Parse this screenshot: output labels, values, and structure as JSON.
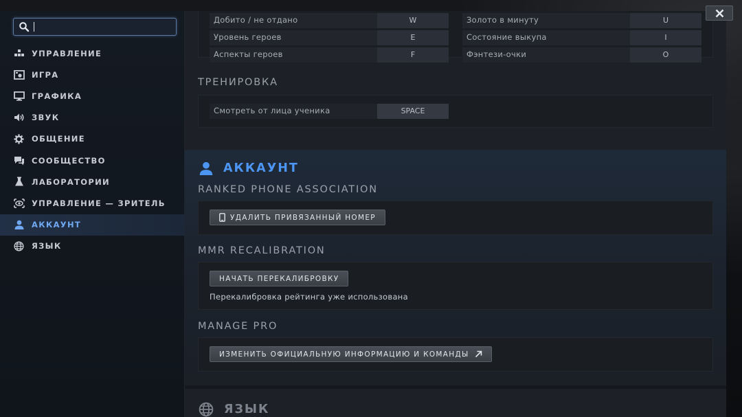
{
  "search": {
    "value": "",
    "placeholder": ""
  },
  "sidebar": {
    "items": [
      {
        "id": "controls",
        "label": "УПРАВЛЕНИЕ",
        "icon": "controls-icon"
      },
      {
        "id": "game",
        "label": "ИГРА",
        "icon": "game-icon"
      },
      {
        "id": "graphics",
        "label": "ГРАФИКА",
        "icon": "monitor-icon"
      },
      {
        "id": "sound",
        "label": "ЗВУК",
        "icon": "speaker-icon"
      },
      {
        "id": "social",
        "label": "ОБЩЕНИЕ",
        "icon": "gear-icon"
      },
      {
        "id": "community",
        "label": "СООБЩЕСТВО",
        "icon": "chat-icon"
      },
      {
        "id": "labs",
        "label": "ЛАБОРАТОРИИ",
        "icon": "flask-icon"
      },
      {
        "id": "spectator",
        "label": "УПРАВЛЕНИЕ — ЗРИТЕЛЬ",
        "icon": "eye-icon"
      },
      {
        "id": "account",
        "label": "АККАУНТ",
        "icon": "user-icon",
        "active": true
      },
      {
        "id": "language",
        "label": "ЯЗЫК",
        "icon": "globe-icon"
      }
    ]
  },
  "keybinds": {
    "left": [
      {
        "label": "Добито / не отдано",
        "key": "W"
      },
      {
        "label": "Уровень героев",
        "key": "E"
      },
      {
        "label": "Аспекты героев",
        "key": "F"
      }
    ],
    "right": [
      {
        "label": "Золото в минуту",
        "key": "U"
      },
      {
        "label": "Состояние выкупа",
        "key": "I"
      },
      {
        "label": "Фэнтези-очки",
        "key": "O"
      }
    ]
  },
  "training": {
    "title": "ТРЕНИРОВКА",
    "bind": {
      "label": "Смотреть от лица ученика",
      "key": "SPACE"
    }
  },
  "account": {
    "title": "АККАУНТ",
    "ranked_phone": {
      "title": "RANKED PHONE ASSOCIATION",
      "button": "УДАЛИТЬ ПРИВЯЗАННЫЙ НОМЕР"
    },
    "mmr": {
      "title": "MMR RECALIBRATION",
      "button": "НАЧАТЬ ПЕРЕКАЛИБРОВКУ",
      "note": "Перекалибровка рейтинга уже использована"
    },
    "manage_pro": {
      "title": "MANAGE PRO",
      "button": "ИЗМЕНИТЬ ОФИЦИАЛЬНУЮ ИНФОРМАЦИЮ И КОМАНДЫ"
    }
  },
  "language": {
    "title": "ЯЗЫК"
  },
  "colors": {
    "accent": "#4d95f2",
    "active_nav_text": "#6fa8f0",
    "panel_bg": "#1d2127",
    "sidebar_bg": "#141a22"
  }
}
